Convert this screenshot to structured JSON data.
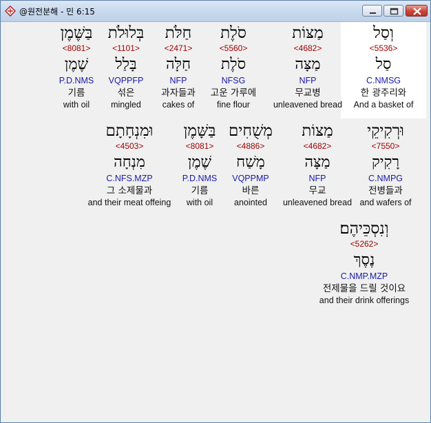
{
  "window": {
    "title": "@원전분해 - 민 6:15",
    "controls": [
      "minimize",
      "maximize",
      "close"
    ],
    "accent": "#c9463a"
  },
  "colors": {
    "strong_number": "#a00000",
    "morphology": "#1a1aa8",
    "selected_background": "#ffffff"
  },
  "rows": [
    {
      "words": [
        {
          "hebrew": "וְסַל",
          "strong": "<5536>",
          "lexeme": "סַל",
          "morph": "C.NMSG",
          "korean": "한 광주리와",
          "english": "And a basket of",
          "selected": true
        },
        {
          "hebrew": "מַצּוֹת",
          "strong": "<4682>",
          "lexeme": "מַצָּה",
          "morph": "NFP",
          "korean": "무교병",
          "english": "unleavened bread",
          "selected": false
        },
        {
          "hebrew": "סֹלֶת",
          "strong": "<5560>",
          "lexeme": "סֹלֶת",
          "morph": "NFSG",
          "korean": "고운 가루에",
          "english": "fine flour",
          "selected": false
        },
        {
          "hebrew": "חַלֹּת",
          "strong": "<2471>",
          "lexeme": "חַלָּה",
          "morph": "NFP",
          "korean": "과자들과",
          "english": "cakes of",
          "selected": false
        },
        {
          "hebrew": "בְּלוּלֹת",
          "strong": "<1101>",
          "lexeme": "בָּלַל",
          "morph": "VQPPFP",
          "korean": "섞은",
          "english": "mingled",
          "selected": false
        },
        {
          "hebrew": "בַּשֶּׁמֶן",
          "strong": "<8081>",
          "lexeme": "שֶׁמֶן",
          "morph": "P.D.NMS",
          "korean": "기름",
          "english": "with oil",
          "selected": false
        }
      ]
    },
    {
      "words": [
        {
          "hebrew": "וּרְקִיקֵי",
          "strong": "<7550>",
          "lexeme": "רָקִיק",
          "morph": "C.NMPG",
          "korean": "전병들과",
          "english": "and wafers of",
          "selected": false
        },
        {
          "hebrew": "מַצּוֹת",
          "strong": "<4682>",
          "lexeme": "מַצָּה",
          "morph": "NFP",
          "korean": "무교",
          "english": "unleavened bread",
          "selected": false
        },
        {
          "hebrew": "מְשֻׁחִים",
          "strong": "<4886>",
          "lexeme": "מָשַׁח",
          "morph": "VQPPMP",
          "korean": "바른",
          "english": "anointed",
          "selected": false
        },
        {
          "hebrew": "בַּשָּׁמֶן",
          "strong": "<8081>",
          "lexeme": "שֶׁמֶן",
          "morph": "P.D.NMS",
          "korean": "기름",
          "english": "with oil",
          "selected": false
        },
        {
          "hebrew": "וּמִנְחָתָם",
          "strong": "<4503>",
          "lexeme": "מִנְחָה",
          "morph": "C.NFS.MZP",
          "korean": "그 소제물과",
          "english": "and their meat offeing",
          "selected": false
        }
      ]
    },
    {
      "words": [
        {
          "hebrew": "וְנִסְכֵּיהֶם׃",
          "strong": "<5262>",
          "lexeme": "נֶסֶךְ",
          "morph": "C.NMP.MZP",
          "korean": "전제물을 드릴 것이요",
          "english": "and their drink offerings",
          "selected": false
        }
      ]
    }
  ]
}
